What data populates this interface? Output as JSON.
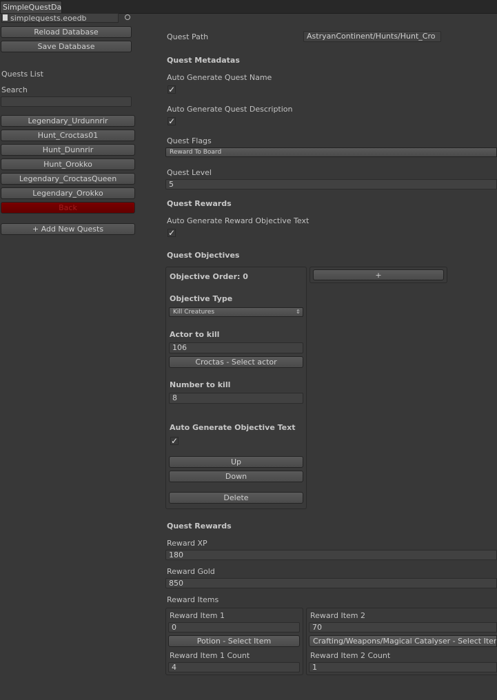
{
  "window": {
    "tab_title": "SimpleQuestDa"
  },
  "file": {
    "name": "simplequests.eoedb",
    "file_icon": "file-icon",
    "target_icon": "target-icon"
  },
  "sidebar": {
    "reload_label": "Reload Database",
    "save_label": "Save Database",
    "quests_list_label": "Quests List",
    "search_label": "Search",
    "search_value": "",
    "quests": [
      "Legendary_Urdunnrir",
      "Hunt_Croctas01",
      "Hunt_Dunnrir",
      "Hunt_Orokko",
      "Legendary_CroctasQueen",
      "Legendary_Orokko"
    ],
    "back_label": "Back",
    "add_label": "+ Add New Quests"
  },
  "quest": {
    "path_label": "Quest Path",
    "path_value": "AstryanContinent/Hunts/Hunt_Cro",
    "metadatas_header": "Quest Metadatas",
    "auto_name_label": "Auto Generate Quest Name",
    "auto_name_checked": "✓",
    "auto_desc_label": "Auto Generate Quest Description",
    "auto_desc_checked": "✓",
    "flags_label": "Quest Flags",
    "flags_value": "Reward To Board",
    "level_label": "Quest Level",
    "level_value": "5",
    "rewards_header": "Quest Rewards",
    "auto_reward_label": "Auto Generate Reward Objective Text",
    "auto_reward_checked": "✓",
    "objectives_header": "Quest Objectives",
    "add_objective_label": "+"
  },
  "objective": {
    "order_label": "Objective Order: 0",
    "type_label": "Objective Type",
    "type_value": "Kill Creatures",
    "actor_label": "Actor to kill",
    "actor_value": "106",
    "select_actor_label": "Croctas - Select actor",
    "number_label": "Number to kill",
    "number_value": "8",
    "auto_text_label": "Auto Generate Objective Text",
    "auto_text_checked": "✓",
    "up_label": "Up",
    "down_label": "Down",
    "delete_label": "Delete"
  },
  "rewards": {
    "header": "Quest Rewards",
    "xp_label": "Reward XP",
    "xp_value": "180",
    "gold_label": "Reward Gold",
    "gold_value": "850",
    "items_label": "Reward Items",
    "item1": {
      "label": "Reward Item 1",
      "value": "0",
      "select_label": "Potion - Select Item",
      "count_label": "Reward Item 1 Count",
      "count_value": "4"
    },
    "item2": {
      "label": "Reward Item 2",
      "value": "70",
      "select_label": "Crafting/Weapons/Magical Catalyser - Select Item",
      "count_label": "Reward Item 2 Count",
      "count_value": "1"
    }
  },
  "colors": {
    "background": "#383838",
    "back_button": "#6e0000",
    "back_text": "#a31d1d"
  }
}
